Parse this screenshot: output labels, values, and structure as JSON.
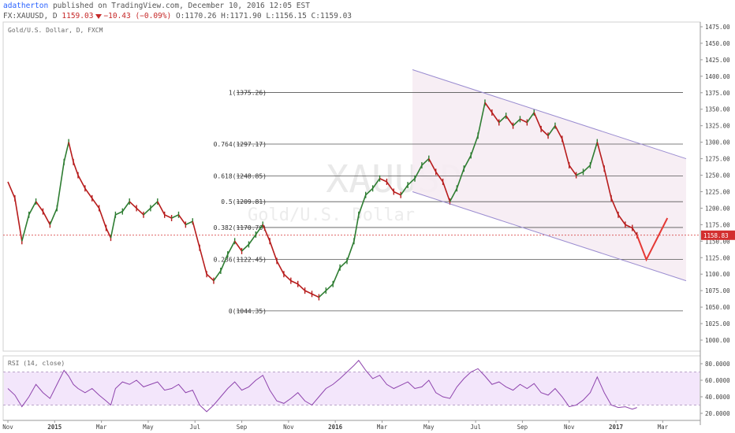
{
  "header": {
    "user": "adatherton",
    "published": "published on TradingView.com, December 10, 2016 12:05 EST",
    "ticker": "FX:XAUUSD, D",
    "close_val": "1159.03",
    "change": "−10.43 (−0.09%)",
    "ohlc": "O:1170.26 H:1171.90 L:1156.15 C:1159.03"
  },
  "main_label": "Gold/U.S. Dollar, D, FXCM",
  "watermark": {
    "symbol": "XAUUSD",
    "name": "Gold/U.S. Dollar"
  },
  "price_label": "1158.83",
  "rsi_label": "RSI (14, close)",
  "colors": {
    "up": "#2e7d32",
    "down": "#b71c1c",
    "channel": "#9a8cd0",
    "rsi": "#8e44ad",
    "arrow": "#e53935",
    "price_label_bg": "#d32f2f"
  },
  "chart_data": {
    "type": "line",
    "title": "Gold/U.S. Dollar, D, FXCM",
    "xlabel": "",
    "ylabel": "",
    "x_ticks": [
      "Nov",
      "2015",
      "Mar",
      "May",
      "Jul",
      "Sep",
      "Nov",
      "2016",
      "Mar",
      "May",
      "Jul",
      "Sep",
      "Nov",
      "2017",
      "Mar"
    ],
    "y_ticks": [
      1000,
      1025,
      1050,
      1075,
      1100,
      1125,
      1150,
      1175,
      1200,
      1225,
      1250,
      1275,
      1300,
      1325,
      1350,
      1375,
      1400,
      1425,
      1450,
      1475
    ],
    "y_tick_labels": [
      "1000.00",
      "1025.00",
      "1050.00",
      "1075.00",
      "1100.00",
      "1125.00",
      "1150.00",
      "1175.00",
      "1200.00",
      "1225.00",
      "1250.00",
      "1275.00",
      "1300.00",
      "1325.00",
      "1350.00",
      "1375.00",
      "1400.00",
      "1425.00",
      "1450.00",
      "1475.00"
    ],
    "ylim": [
      985,
      1485
    ],
    "x_range_months": [
      0,
      29
    ],
    "grid": false,
    "series": [
      {
        "kind": "price",
        "points": [
          [
            0.0,
            1240
          ],
          [
            0.3,
            1215
          ],
          [
            0.6,
            1150
          ],
          [
            0.9,
            1190
          ],
          [
            1.2,
            1210
          ],
          [
            1.5,
            1195
          ],
          [
            1.8,
            1175
          ],
          [
            2.1,
            1200
          ],
          [
            2.4,
            1270
          ],
          [
            2.6,
            1300
          ],
          [
            2.8,
            1270
          ],
          [
            3.0,
            1250
          ],
          [
            3.3,
            1230
          ],
          [
            3.6,
            1215
          ],
          [
            3.9,
            1200
          ],
          [
            4.2,
            1170
          ],
          [
            4.4,
            1155
          ],
          [
            4.6,
            1190
          ],
          [
            4.9,
            1195
          ],
          [
            5.2,
            1210
          ],
          [
            5.5,
            1200
          ],
          [
            5.8,
            1190
          ],
          [
            6.1,
            1200
          ],
          [
            6.4,
            1210
          ],
          [
            6.7,
            1190
          ],
          [
            7.0,
            1185
          ],
          [
            7.3,
            1190
          ],
          [
            7.6,
            1175
          ],
          [
            7.9,
            1180
          ],
          [
            8.2,
            1140
          ],
          [
            8.5,
            1100
          ],
          [
            8.8,
            1090
          ],
          [
            9.1,
            1105
          ],
          [
            9.4,
            1130
          ],
          [
            9.7,
            1150
          ],
          [
            10.0,
            1135
          ],
          [
            10.3,
            1145
          ],
          [
            10.6,
            1160
          ],
          [
            10.9,
            1175
          ],
          [
            11.2,
            1150
          ],
          [
            11.5,
            1120
          ],
          [
            11.8,
            1100
          ],
          [
            12.1,
            1090
          ],
          [
            12.4,
            1085
          ],
          [
            12.7,
            1075
          ],
          [
            13.0,
            1070
          ],
          [
            13.3,
            1065
          ],
          [
            13.6,
            1075
          ],
          [
            13.9,
            1085
          ],
          [
            14.2,
            1110
          ],
          [
            14.5,
            1120
          ],
          [
            14.8,
            1150
          ],
          [
            15.0,
            1190
          ],
          [
            15.3,
            1220
          ],
          [
            15.6,
            1230
          ],
          [
            15.9,
            1245
          ],
          [
            16.2,
            1240
          ],
          [
            16.5,
            1225
          ],
          [
            16.8,
            1220
          ],
          [
            17.1,
            1235
          ],
          [
            17.4,
            1245
          ],
          [
            17.7,
            1265
          ],
          [
            18.0,
            1275
          ],
          [
            18.3,
            1255
          ],
          [
            18.6,
            1240
          ],
          [
            18.9,
            1210
          ],
          [
            19.2,
            1230
          ],
          [
            19.5,
            1260
          ],
          [
            19.8,
            1280
          ],
          [
            20.1,
            1310
          ],
          [
            20.4,
            1360
          ],
          [
            20.7,
            1345
          ],
          [
            21.0,
            1330
          ],
          [
            21.3,
            1340
          ],
          [
            21.6,
            1325
          ],
          [
            21.9,
            1335
          ],
          [
            22.2,
            1330
          ],
          [
            22.5,
            1345
          ],
          [
            22.8,
            1320
          ],
          [
            23.1,
            1310
          ],
          [
            23.4,
            1325
          ],
          [
            23.7,
            1305
          ],
          [
            24.0,
            1265
          ],
          [
            24.3,
            1250
          ],
          [
            24.6,
            1255
          ],
          [
            24.9,
            1265
          ],
          [
            25.2,
            1300
          ],
          [
            25.5,
            1260
          ],
          [
            25.8,
            1215
          ],
          [
            26.1,
            1190
          ],
          [
            26.4,
            1175
          ],
          [
            26.7,
            1170
          ],
          [
            26.9,
            1159
          ]
        ]
      },
      {
        "kind": "fib",
        "levels": [
          {
            "name": "1(1375.26)",
            "value": 1375.26
          },
          {
            "name": "0.764(1297.17)",
            "value": 1297.17
          },
          {
            "name": "0.618(1248.85)",
            "value": 1248.85
          },
          {
            "name": "0.5(1209.81)",
            "value": 1209.81
          },
          {
            "name": "0.382(1170.76)",
            "value": 1170.76
          },
          {
            "name": "0.236(1122.45)",
            "value": 1122.45
          },
          {
            "name": "0(1044.35)",
            "value": 1044.35
          }
        ]
      },
      {
        "kind": "channel",
        "upper": [
          [
            17.3,
            1410
          ],
          [
            29.0,
            1275
          ]
        ],
        "lower": [
          [
            17.3,
            1225
          ],
          [
            29.0,
            1090
          ]
        ]
      },
      {
        "kind": "projection",
        "points": [
          [
            26.9,
            1159
          ],
          [
            27.3,
            1122
          ],
          [
            28.2,
            1185
          ]
        ]
      },
      {
        "kind": "rsi",
        "ylim": [
          15,
          88
        ],
        "y_ticks": [
          20,
          40,
          60,
          80
        ],
        "y_tick_labels": [
          "20.0000",
          "40.0000",
          "60.0000",
          "80.0000"
        ],
        "bands": [
          30,
          70
        ],
        "points": [
          [
            0.0,
            50
          ],
          [
            0.3,
            42
          ],
          [
            0.6,
            28
          ],
          [
            0.9,
            40
          ],
          [
            1.2,
            55
          ],
          [
            1.5,
            45
          ],
          [
            1.8,
            38
          ],
          [
            2.1,
            55
          ],
          [
            2.4,
            72
          ],
          [
            2.6,
            65
          ],
          [
            2.8,
            55
          ],
          [
            3.0,
            50
          ],
          [
            3.3,
            45
          ],
          [
            3.6,
            50
          ],
          [
            3.9,
            42
          ],
          [
            4.2,
            35
          ],
          [
            4.4,
            30
          ],
          [
            4.6,
            50
          ],
          [
            4.9,
            58
          ],
          [
            5.2,
            55
          ],
          [
            5.5,
            60
          ],
          [
            5.8,
            52
          ],
          [
            6.1,
            55
          ],
          [
            6.4,
            58
          ],
          [
            6.7,
            48
          ],
          [
            7.0,
            50
          ],
          [
            7.3,
            55
          ],
          [
            7.6,
            45
          ],
          [
            7.9,
            48
          ],
          [
            8.2,
            30
          ],
          [
            8.5,
            22
          ],
          [
            8.8,
            30
          ],
          [
            9.1,
            40
          ],
          [
            9.4,
            50
          ],
          [
            9.7,
            58
          ],
          [
            10.0,
            48
          ],
          [
            10.3,
            52
          ],
          [
            10.6,
            60
          ],
          [
            10.9,
            66
          ],
          [
            11.2,
            48
          ],
          [
            11.5,
            35
          ],
          [
            11.8,
            32
          ],
          [
            12.1,
            38
          ],
          [
            12.4,
            45
          ],
          [
            12.7,
            35
          ],
          [
            13.0,
            30
          ],
          [
            13.3,
            40
          ],
          [
            13.6,
            50
          ],
          [
            13.9,
            55
          ],
          [
            14.2,
            62
          ],
          [
            14.5,
            70
          ],
          [
            14.8,
            78
          ],
          [
            15.0,
            84
          ],
          [
            15.3,
            72
          ],
          [
            15.6,
            62
          ],
          [
            15.9,
            66
          ],
          [
            16.2,
            55
          ],
          [
            16.5,
            50
          ],
          [
            16.8,
            54
          ],
          [
            17.1,
            58
          ],
          [
            17.4,
            50
          ],
          [
            17.7,
            52
          ],
          [
            18.0,
            60
          ],
          [
            18.3,
            45
          ],
          [
            18.6,
            40
          ],
          [
            18.9,
            38
          ],
          [
            19.2,
            52
          ],
          [
            19.5,
            62
          ],
          [
            19.8,
            70
          ],
          [
            20.1,
            74
          ],
          [
            20.4,
            65
          ],
          [
            20.7,
            55
          ],
          [
            21.0,
            58
          ],
          [
            21.3,
            52
          ],
          [
            21.6,
            48
          ],
          [
            21.9,
            55
          ],
          [
            22.2,
            50
          ],
          [
            22.5,
            56
          ],
          [
            22.8,
            45
          ],
          [
            23.1,
            42
          ],
          [
            23.4,
            50
          ],
          [
            23.7,
            40
          ],
          [
            24.0,
            28
          ],
          [
            24.3,
            30
          ],
          [
            24.6,
            36
          ],
          [
            24.9,
            45
          ],
          [
            25.2,
            64
          ],
          [
            25.5,
            45
          ],
          [
            25.8,
            30
          ],
          [
            26.1,
            27
          ],
          [
            26.4,
            28
          ],
          [
            26.7,
            25
          ],
          [
            26.9,
            27
          ]
        ]
      }
    ]
  }
}
